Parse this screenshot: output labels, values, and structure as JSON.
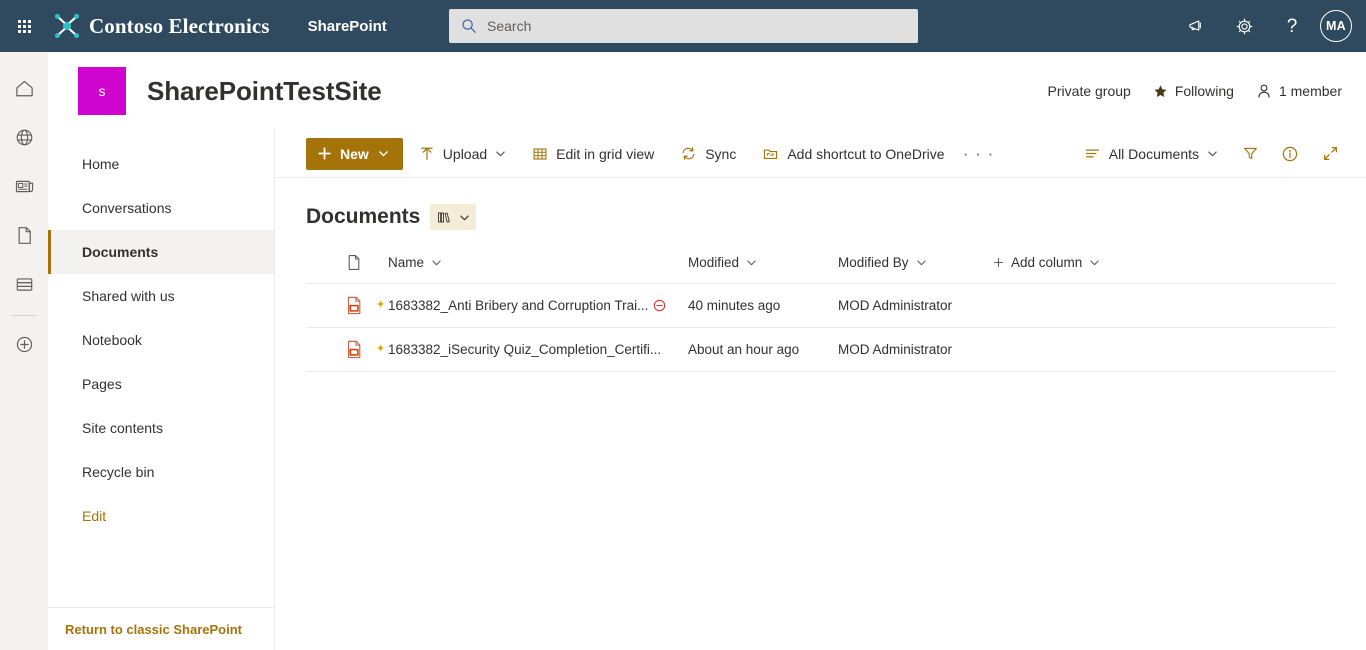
{
  "suite": {
    "waffle_label": "App launcher",
    "brand": "Contoso Electronics",
    "app_name": "SharePoint",
    "search": {
      "placeholder": "Search",
      "value": ""
    },
    "actions": [
      {
        "name": "megaphone-icon",
        "label": "What's new"
      },
      {
        "name": "gear-icon",
        "label": "Settings"
      },
      {
        "name": "help-icon",
        "label": "Help"
      }
    ],
    "avatar_initials": "MA",
    "colors": {
      "header_bg": "#2f4a5e",
      "accent": "#a4740b",
      "brand_teal": "#29c2c9"
    }
  },
  "app_rail": {
    "items": [
      {
        "name": "home-icon",
        "label": "Home"
      },
      {
        "name": "globe-icon",
        "label": "My sites"
      },
      {
        "name": "news-icon",
        "label": "News"
      },
      {
        "name": "document-icon",
        "label": "Files"
      },
      {
        "name": "lists-icon",
        "label": "Lists"
      },
      {
        "name": "create-icon",
        "label": "Create"
      }
    ]
  },
  "site": {
    "logo_letter": "s",
    "logo_color": "#d004cf",
    "title": "SharePointTestSite",
    "privacy": "Private group",
    "following_label": "Following",
    "members_label": "1 member"
  },
  "nav": {
    "items": [
      {
        "label": "Home",
        "selected": false,
        "link": false
      },
      {
        "label": "Conversations",
        "selected": false,
        "link": false
      },
      {
        "label": "Documents",
        "selected": true,
        "link": false
      },
      {
        "label": "Shared with us",
        "selected": false,
        "link": false
      },
      {
        "label": "Notebook",
        "selected": false,
        "link": false
      },
      {
        "label": "Pages",
        "selected": false,
        "link": false
      },
      {
        "label": "Site contents",
        "selected": false,
        "link": false
      },
      {
        "label": "Recycle bin",
        "selected": false,
        "link": false
      },
      {
        "label": "Edit",
        "selected": false,
        "link": true
      }
    ],
    "footer_link": "Return to classic SharePoint"
  },
  "command_bar": {
    "new_label": "New",
    "upload_label": "Upload",
    "edit_grid_label": "Edit in grid view",
    "sync_label": "Sync",
    "shortcut_label": "Add shortcut to OneDrive",
    "overflow_label": "· · ·",
    "view_label": "All Documents",
    "filter_label": "Filter",
    "info_label": "Details",
    "expand_label": "Expand"
  },
  "list": {
    "title": "Documents",
    "view_switch_label": "Switch view",
    "columns": [
      {
        "label": "Name",
        "sortable": true
      },
      {
        "label": "Modified",
        "sortable": true
      },
      {
        "label": "Modified By",
        "sortable": true
      },
      {
        "label": "Add column",
        "sortable": true
      }
    ],
    "rows": [
      {
        "icon": "pdf-file-icon",
        "is_new": true,
        "name": "1683382_Anti Bribery and Corruption Trai...",
        "blocked": true,
        "modified": "40 minutes ago",
        "modified_by": "MOD Administrator"
      },
      {
        "icon": "pdf-file-icon",
        "is_new": true,
        "name": "1683382_iSecurity Quiz_Completion_Certifi...",
        "blocked": false,
        "modified": "About an hour ago",
        "modified_by": "MOD Administrator"
      }
    ]
  }
}
